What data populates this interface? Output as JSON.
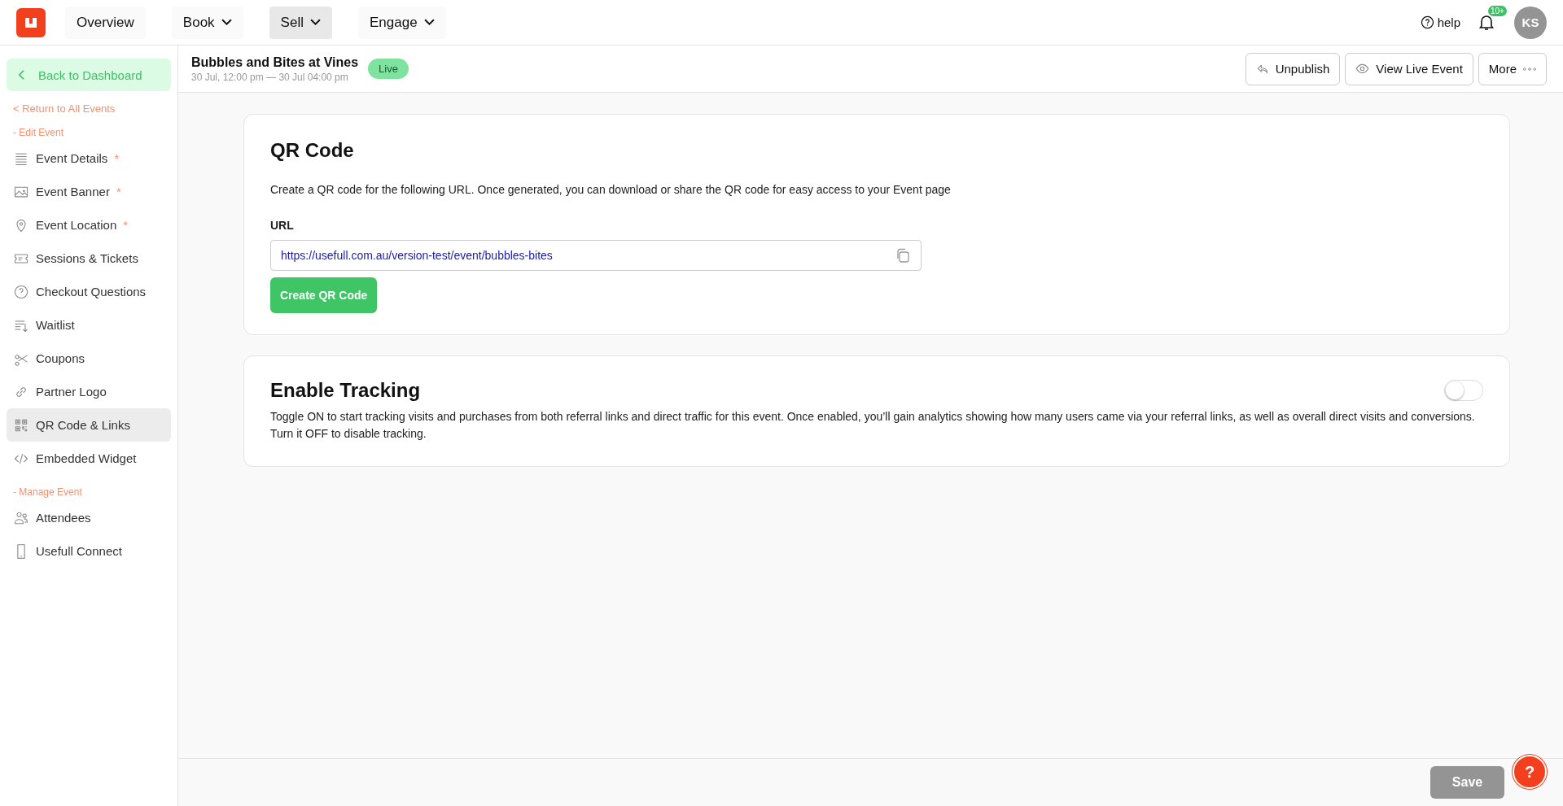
{
  "top_nav": {
    "items": [
      {
        "label": "Overview",
        "has_menu": false,
        "selected": false
      },
      {
        "label": "Book",
        "has_menu": true,
        "selected": false
      },
      {
        "label": "Sell",
        "has_menu": true,
        "selected": true
      },
      {
        "label": "Engage",
        "has_menu": true,
        "selected": false
      }
    ],
    "help": "help",
    "notification_badge": "10+",
    "avatar": "KS"
  },
  "sidebar": {
    "back_button": "Back to Dashboard",
    "return_link": "< Return to All Events",
    "sections": [
      {
        "heading": "- Edit Event",
        "items": [
          {
            "label": "Event Details",
            "required_mark": "*",
            "selected": false
          },
          {
            "label": "Event Banner",
            "required_mark": "*",
            "selected": false
          },
          {
            "label": "Event Location",
            "required_mark": "*",
            "selected": false
          },
          {
            "label": "Sessions & Tickets",
            "selected": false
          },
          {
            "label": "Checkout Questions",
            "selected": false
          },
          {
            "label": "Waitlist",
            "selected": false
          },
          {
            "label": "Coupons",
            "selected": false
          },
          {
            "label": "Partner Logo",
            "selected": false
          },
          {
            "label": "QR Code & Links",
            "selected": true
          },
          {
            "label": "Embedded Widget",
            "selected": false
          }
        ]
      },
      {
        "heading": "- Manage Event",
        "items": [
          {
            "label": "Attendees",
            "selected": false
          },
          {
            "label": "Usefull Connect",
            "selected": false
          }
        ]
      }
    ]
  },
  "event": {
    "title": "Bubbles and Bites at Vines",
    "dates": "30 Jul, 12:00 pm — 30 Jul 04:00 pm",
    "status": "Live",
    "actions": [
      {
        "label": "Unpublish"
      },
      {
        "label": "View Live Event"
      },
      {
        "label": "More"
      }
    ]
  },
  "qr_card": {
    "title": "QR Code",
    "description": "Create a QR code for the following URL. Once generated, you can download or share the QR code for easy access to your Event page",
    "field_label": "URL",
    "url": "https://usefull.com.au/version-test/event/bubbles-bites",
    "button": "Create QR Code"
  },
  "tracking_card": {
    "title": "Enable Tracking",
    "on": false,
    "description": "Toggle ON to start tracking visits and purchases from both referral links and direct traffic for this event. Once enabled, you’ll gain analytics showing how many users came via your referral links, as well as overall direct visits and conversions. Turn it OFF to disable tracking."
  },
  "footer": {
    "save_button": "Save",
    "help_button": "?"
  }
}
